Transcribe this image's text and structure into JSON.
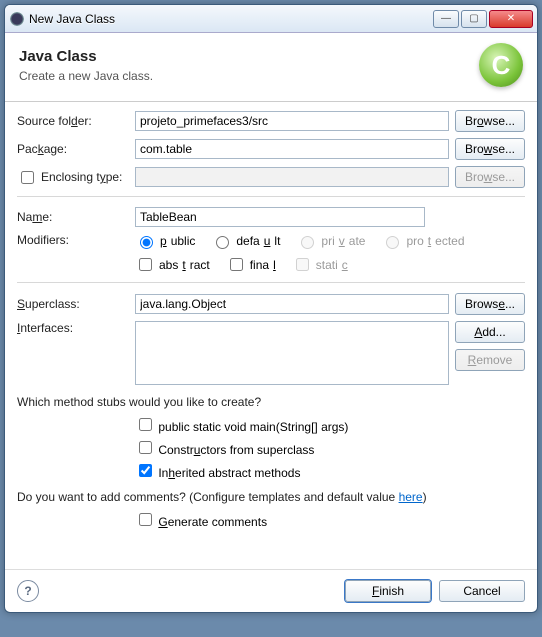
{
  "window_title": "New Java Class",
  "header": {
    "title": "Java Class",
    "subtitle": "Create a new Java class.",
    "icon_letter": "C"
  },
  "labels": {
    "source_folder": "Source folder:",
    "package": "Package:",
    "enclosing": "Enclosing type:",
    "name": "Name:",
    "modifiers": "Modifiers:",
    "superclass": "Superclass:",
    "interfaces": "Interfaces:"
  },
  "fields": {
    "source_folder": "projeto_primefaces3/src",
    "package": "com.table",
    "enclosing": "",
    "name": "TableBean",
    "superclass": "java.lang.Object"
  },
  "buttons": {
    "browse": "Browse...",
    "add": "Add...",
    "remove": "Remove",
    "finish": "Finish",
    "cancel": "Cancel"
  },
  "modifiers": {
    "public": "public",
    "default": "default",
    "private": "private",
    "protected": "protected",
    "abstract": "abstract",
    "final": "final",
    "static": "static"
  },
  "stubs": {
    "question": "Which method stubs would you like to create?",
    "main": "public static void main(String[] args)",
    "constructors": "Constructors from superclass",
    "inherited": "Inherited abstract methods"
  },
  "comments": {
    "question_pre": "Do you want to add comments? (Configure templates and default value ",
    "link": "here",
    "question_post": ")",
    "generate": "Generate comments"
  }
}
